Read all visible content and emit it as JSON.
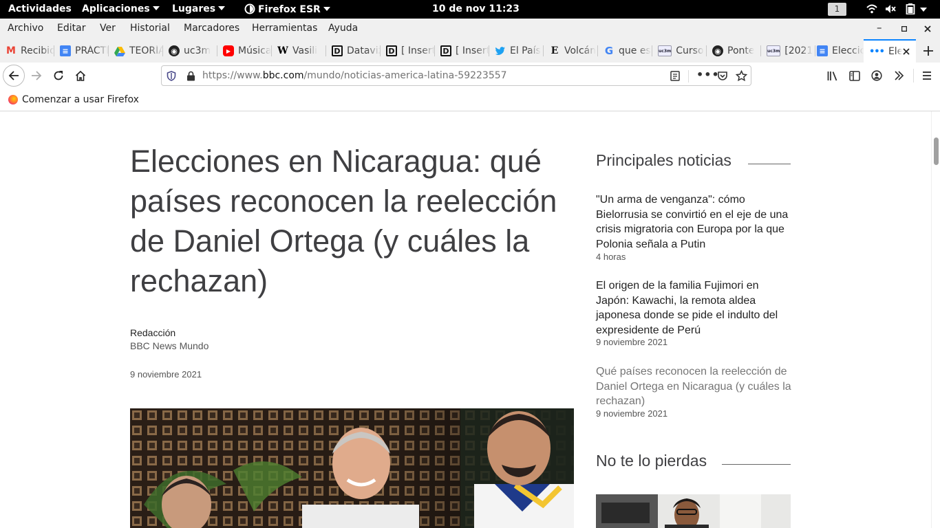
{
  "system_bar": {
    "activities": "Actividades",
    "applications": "Aplicaciones",
    "places": "Lugares",
    "app_name": "Firefox ESR",
    "clock": "10 de nov  11:23",
    "workspace": "1"
  },
  "menubar": {
    "items": [
      "Archivo",
      "Editar",
      "Ver",
      "Historial",
      "Marcadores",
      "Herramientas",
      "Ayuda"
    ]
  },
  "tabs": [
    {
      "title": "Recibidos",
      "icon": "gmail-icon"
    },
    {
      "title": "PRÁCTICA",
      "icon": "google-docs-icon"
    },
    {
      "title": "TEORÍA",
      "icon": "google-drive-icon"
    },
    {
      "title": "uc3m",
      "icon": "github-icon"
    },
    {
      "title": "Música",
      "icon": "youtube-icon"
    },
    {
      "title": "Vasili",
      "icon": "wikipedia-icon"
    },
    {
      "title": "Dataviz",
      "icon": "d-letter-icon"
    },
    {
      "title": "[ Insert",
      "icon": "d-letter-icon"
    },
    {
      "title": "[ Insert",
      "icon": "d-letter-icon"
    },
    {
      "title": "El País",
      "icon": "twitter-icon"
    },
    {
      "title": "Volcán",
      "icon": "e-letter-icon"
    },
    {
      "title": "que es",
      "icon": "google-icon"
    },
    {
      "title": "Curso",
      "icon": "uc3m-icon"
    },
    {
      "title": "Ponte",
      "icon": "github-icon"
    },
    {
      "title": "[2021",
      "icon": "uc3m-icon"
    },
    {
      "title": "Elecciones",
      "icon": "google-docs-icon"
    },
    {
      "title": "Elecciones",
      "icon": "loading-dots-icon",
      "active": true
    }
  ],
  "navbar": {
    "url_prefix": "https://www.",
    "url_domain": "bbc.com",
    "url_path": "/mundo/noticias-america-latina-59223557"
  },
  "bookmarks": {
    "getting_started": "Comenzar a usar Firefox"
  },
  "article": {
    "headline": "Elecciones en Nicaragua: qué países reconocen la reelección de Daniel Ortega (y cuáles la rechazan)",
    "author": "Redacción",
    "organization": "BBC News Mundo",
    "date": "9 noviembre 2021"
  },
  "sidebar": {
    "top_stories_heading": "Principales noticias",
    "stories": [
      {
        "title": "\"Un arma de venganza\": cómo Bielorrusia se convirtió en el eje de una crisis migratoria con Europa por la que Polonia señala a Putin",
        "time": "4 horas"
      },
      {
        "title": "El origen de la familia Fujimori en Japón: Kawachi, la remota aldea japonesa donde se pide el indulto del expresidente de Perú",
        "time": "9 noviembre 2021"
      },
      {
        "title": "Qué países reconocen la reelección de Daniel Ortega en Nicaragua (y cuáles la rechazan)",
        "time": "9 noviembre 2021"
      }
    ],
    "dont_miss_heading": "No te lo pierdas"
  }
}
